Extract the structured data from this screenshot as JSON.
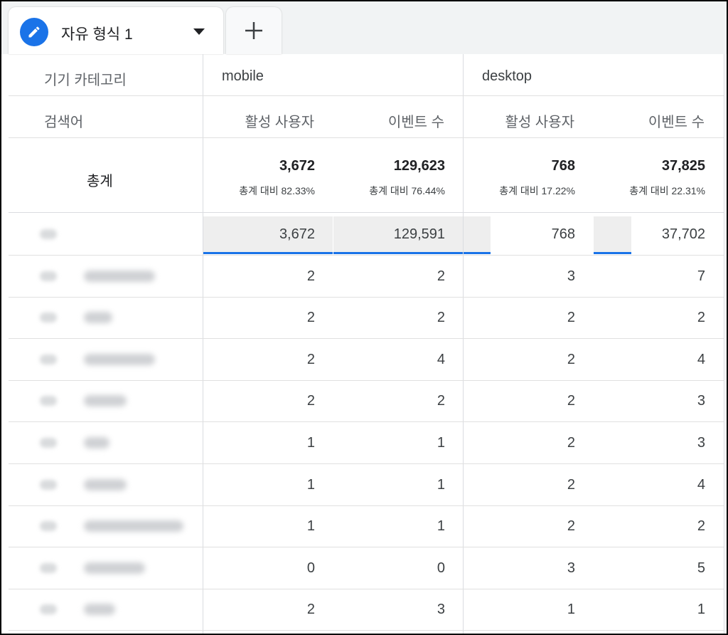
{
  "tabs": {
    "active_label": "자유 형식 1",
    "add_label": "+"
  },
  "table": {
    "dimension_header": "기기 카테고리",
    "row_dimension_header": "검색어",
    "groups": [
      {
        "name": "mobile"
      },
      {
        "name": "desktop"
      }
    ],
    "metrics": [
      "활성 사용자",
      "이벤트 수",
      "활성 사용자",
      "이벤트 수"
    ],
    "totals": {
      "label": "총계",
      "values": [
        "3,672",
        "129,623",
        "768",
        "37,825"
      ],
      "percents": [
        "총계 대비 82.33%",
        "총계 대비 76.44%",
        "총계 대비 17.22%",
        "총계 대비 22.31%"
      ]
    },
    "rows": [
      {
        "values": [
          "3,672",
          "129,591",
          "768",
          "37,702"
        ],
        "shares": [
          1.0,
          1.0,
          0.21,
          0.29
        ]
      },
      {
        "values": [
          "2",
          "2",
          "3",
          "7"
        ]
      },
      {
        "values": [
          "2",
          "2",
          "2",
          "2"
        ]
      },
      {
        "values": [
          "2",
          "4",
          "2",
          "4"
        ]
      },
      {
        "values": [
          "2",
          "2",
          "2",
          "3"
        ]
      },
      {
        "values": [
          "1",
          "1",
          "2",
          "3"
        ]
      },
      {
        "values": [
          "1",
          "1",
          "2",
          "4"
        ]
      },
      {
        "values": [
          "1",
          "1",
          "2",
          "2"
        ]
      },
      {
        "values": [
          "0",
          "0",
          "3",
          "5"
        ]
      },
      {
        "values": [
          "2",
          "3",
          "1",
          "1"
        ]
      }
    ]
  },
  "colors": {
    "accent": "#1a73e8",
    "bar_bg": "#eeeeee",
    "grid": "#dadce0"
  }
}
